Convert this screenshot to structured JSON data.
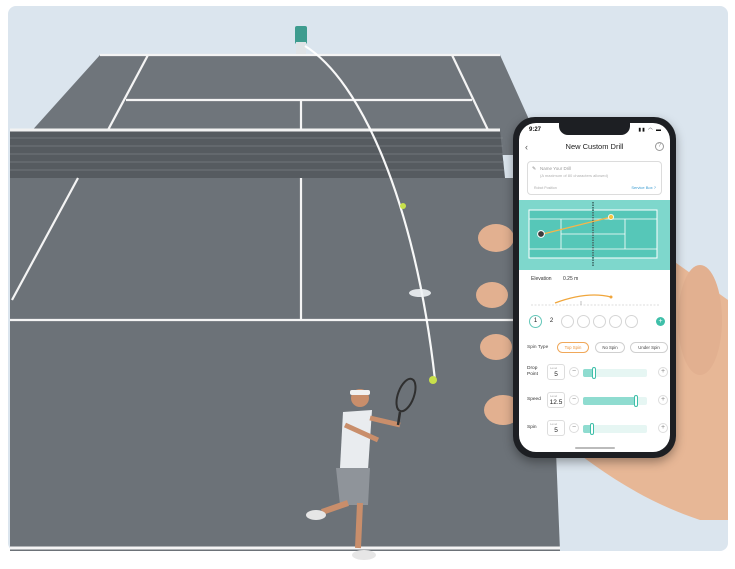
{
  "phone": {
    "status_time": "9:27",
    "title": "New Custom Drill",
    "name_field": {
      "placeholder": "Name Your Drill",
      "hint": "(A maximum of 80 characters allowed)",
      "robot_position_label": "Robot Position",
      "service_box_label": "Service Box ?"
    },
    "elevation": {
      "label": "Elevation",
      "value": "0.25 m"
    },
    "ball_slots": [
      "1",
      "2",
      "",
      "",
      "",
      "",
      ""
    ],
    "spin_type": {
      "label": "Spin Type",
      "options": [
        "Top Spin",
        "No Spin",
        "Under Spin"
      ],
      "selected": "Top Spin"
    },
    "params": [
      {
        "label": "Drop Point",
        "level_label": "Level",
        "value": "5",
        "fraction": 0.15
      },
      {
        "label": "Speed",
        "level_label": "Level",
        "value": "12.5",
        "fraction": 0.85
      },
      {
        "label": "Spin",
        "level_label": "Level",
        "value": "5",
        "fraction": 0.12
      }
    ]
  },
  "colors": {
    "background": "#dbe5ee",
    "court": "#6f757b",
    "accent": "#3fbfa9",
    "spin_selected": "#e9953e"
  }
}
